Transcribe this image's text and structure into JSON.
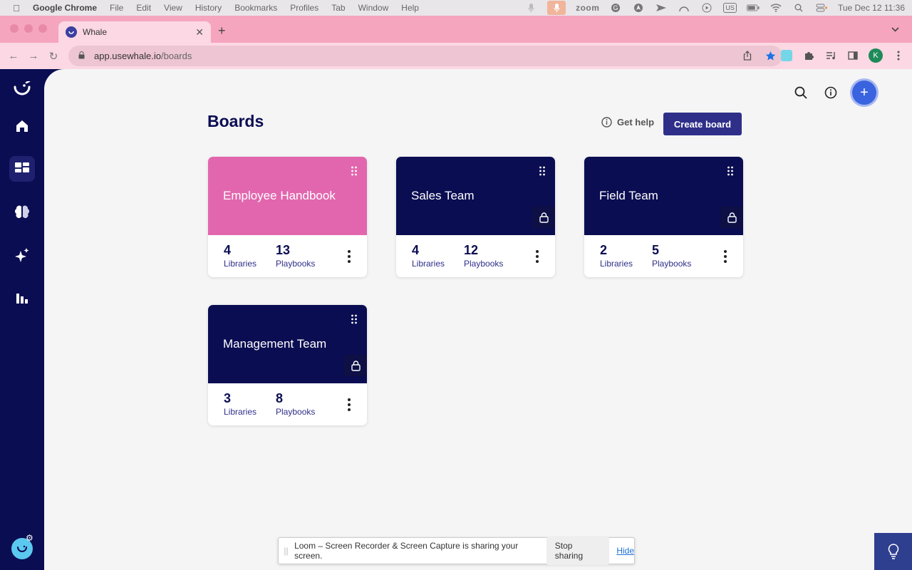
{
  "menubar": {
    "app_name": "Google Chrome",
    "items": [
      "File",
      "Edit",
      "View",
      "History",
      "Bookmarks",
      "Profiles",
      "Tab",
      "Window",
      "Help"
    ],
    "zoom_label": "zoom",
    "input_source": "US",
    "datetime": "Tue Dec 12  11:36"
  },
  "browser": {
    "tab_title": "Whale",
    "url_host": "app.usewhale.io",
    "url_path": "/boards",
    "profile_initial": "K"
  },
  "header": {
    "title": "Boards",
    "get_help": "Get help",
    "create_board": "Create board"
  },
  "boards": [
    {
      "name": "Employee Handbook",
      "libraries": "4",
      "playbooks": "13",
      "color": "#e266ae",
      "locked": false
    },
    {
      "name": "Sales Team",
      "libraries": "4",
      "playbooks": "12",
      "color": "#0b0d52",
      "locked": true
    },
    {
      "name": "Field Team",
      "libraries": "2",
      "playbooks": "5",
      "color": "#0b0d52",
      "locked": true
    },
    {
      "name": "Management Team",
      "libraries": "3",
      "playbooks": "8",
      "color": "#0b0d52",
      "locked": true
    }
  ],
  "labels": {
    "libraries": "Libraries",
    "playbooks": "Playbooks"
  },
  "loom": {
    "message": "Loom – Screen Recorder & Screen Capture is sharing your screen.",
    "stop": "Stop sharing",
    "hide": "Hide"
  },
  "colors": {
    "sidebar": "#0b0d52",
    "accent": "#2f2f8a",
    "tab_strip": "#f6a5bf"
  }
}
